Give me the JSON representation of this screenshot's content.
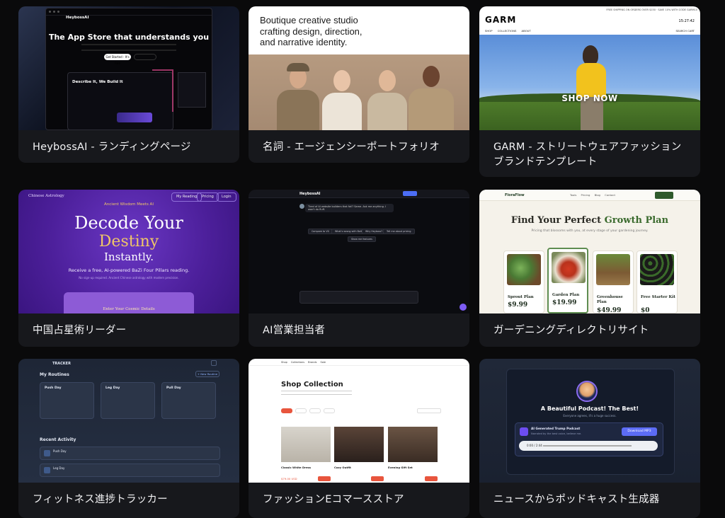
{
  "cards": [
    {
      "caption": "HeybossAI - ランディングページ",
      "thumb": {
        "logo": "HeybossAI",
        "headline": "The App Store that understands you",
        "cta": "Get Started - It's free",
        "section_title": "Describe It, We Build It"
      }
    },
    {
      "caption": "名詞 - エージェンシーポートフォリオ",
      "thumb": {
        "headline_line1": "Boutique creative studio",
        "headline_line2": "crafting design, direction,",
        "headline_line3": "and narrative identity."
      }
    },
    {
      "caption": "GARM - ストリートウェアファッションブランドテンプレート",
      "thumb": {
        "brand": "GARM",
        "ticker": "FREE SHIPPING ON ORDERS OVER $150 · SAVE 10% WITH CODE GARM10",
        "time": "15:27:42",
        "nav": "SHOP COLLECTIONS ABOUT",
        "nav_right": "SEARCH CART",
        "hero_cta": "SHOP NOW"
      }
    },
    {
      "caption": "中国占星術リーダー",
      "thumb": {
        "site_name": "Chinese Astrology",
        "nav": [
          "My Reading",
          "Pricing",
          "Login"
        ],
        "tagline": "Ancient Wisdom Meets AI",
        "headline_line1": "Decode Your",
        "headline_line2": "Destiny",
        "headline_line3": "Instantly.",
        "subtext": "Receive a free, AI-powered BaZi Four Pillars reading.",
        "note": "No sign-up required. Ancient Chinese astrology with modern precision.",
        "form_title": "Enter Your Cosmic Details"
      }
    },
    {
      "caption": "AI営業担当者",
      "thumb": {
        "logo": "HeybossAI",
        "message": "Tired of AI website builders that fail? Same. Ask me anything. I won't do fluff.",
        "chips": [
          "Compare to V0",
          "What's wrong with Bolt?",
          "Why Heyboss?",
          "Tell me about pricing",
          "Show me features"
        ]
      }
    },
    {
      "caption": "ガーデニングディレクトリサイト",
      "thumb": {
        "logo": "FloraFlow",
        "nav": "Tools Pricing Blog Contact",
        "headline_prefix": "Find Your Perfect ",
        "headline_accent": "Growth Plan",
        "subtext": "Pricing that blossoms with you, at every stage of your gardening journey.",
        "plans": [
          {
            "name": "Sprout Plan",
            "price": "$9.99"
          },
          {
            "name": "Garden Plan",
            "price": "$19.99"
          },
          {
            "name": "Greenhouse Plan",
            "price": "$49.99"
          },
          {
            "name": "Free Starter Kit",
            "price": "$0"
          }
        ]
      }
    },
    {
      "caption": "フィットネス進捗トラッカー",
      "thumb": {
        "title": "TRACKER",
        "routines_heading": "My Routines",
        "new_routine": "+ New Routine",
        "routines": [
          "Push Day",
          "Leg Day",
          "Pull Day"
        ],
        "activity_heading": "Recent Activity",
        "activities": [
          "Push Day",
          "Leg Day"
        ]
      }
    },
    {
      "caption": "ファッションEコマースストア",
      "thumb": {
        "nav": "Shop Collections Brands Sale",
        "headline": "Shop Collection",
        "products": [
          "Classic White Dress",
          "Cozy Outfit",
          "Evening Gift Set"
        ],
        "price": "$79.00 USD"
      }
    },
    {
      "caption": "ニュースからポッドキャスト生成器",
      "thumb": {
        "title": "A Beautiful Podcast! The Best!",
        "subtitle": "Everyone agrees, it's a huge success.",
        "audio_title": "AI Generated Trump Podcast",
        "audio_note": "Narrated by the best voice, believe me.",
        "download": "Download MP3",
        "player_time": "0:00 / 2:44"
      }
    }
  ]
}
